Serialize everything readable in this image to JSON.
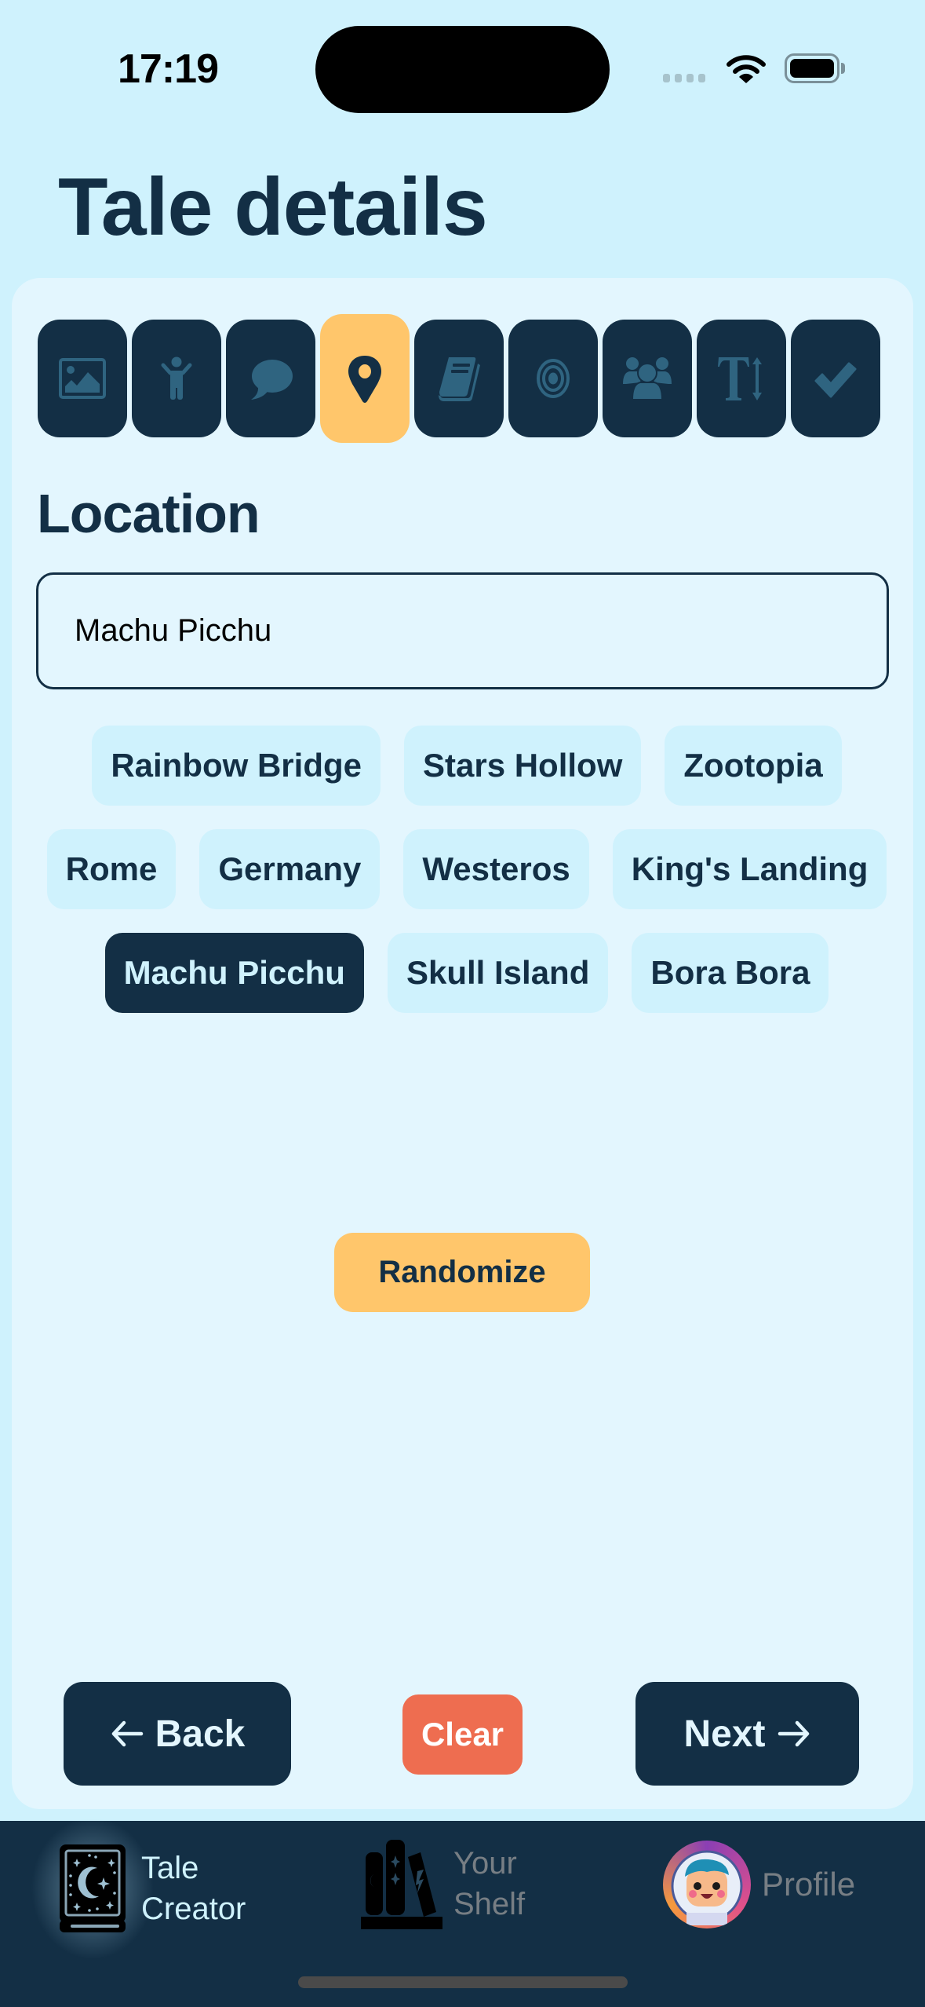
{
  "status_bar": {
    "time": "17:19",
    "icons": [
      "cellular-signal-icon",
      "wifi-icon",
      "battery-icon"
    ]
  },
  "page": {
    "title": "Tale details"
  },
  "steps": [
    {
      "icon": "image-icon",
      "label": "Image",
      "active": false
    },
    {
      "icon": "child-figure-icon",
      "label": "Character",
      "active": false
    },
    {
      "icon": "speech-bubble-icon",
      "label": "Dialogue",
      "active": false
    },
    {
      "icon": "map-pin-icon",
      "label": "Location",
      "active": true
    },
    {
      "icon": "book-icon",
      "label": "Story",
      "active": false
    },
    {
      "icon": "target-icon",
      "label": "Goal",
      "active": false
    },
    {
      "icon": "group-icon",
      "label": "Audience",
      "active": false
    },
    {
      "icon": "text-size-icon",
      "label": "Length",
      "active": false
    },
    {
      "icon": "checkmark-icon",
      "label": "Finish",
      "active": false
    }
  ],
  "location": {
    "section_title": "Location",
    "input_value": "Machu Picchu",
    "suggestions": [
      [
        "Rainbow Bridge",
        "Stars Hollow",
        "Zootopia"
      ],
      [
        "Rome",
        "Germany",
        "Westeros",
        "King's Landing"
      ],
      [
        "Machu Picchu",
        "Skull Island",
        "Bora Bora"
      ]
    ],
    "selected": "Machu Picchu"
  },
  "actions": {
    "randomize": "Randomize",
    "back": "Back",
    "clear": "Clear",
    "next": "Next"
  },
  "tab_bar": {
    "tabs": [
      {
        "line1": "Tale",
        "line2": "Creator",
        "active": true
      },
      {
        "line1": "Your",
        "line2": "Shelf",
        "active": false
      },
      {
        "line1": "Profile",
        "line2": "",
        "active": false
      }
    ]
  },
  "colors": {
    "background": "#cff2fd",
    "card": "#e3f6fe",
    "navy": "#132f45",
    "accent_yellow": "#ffc66b",
    "clear_red": "#ee6d50",
    "icon_muted": "#2f6480"
  }
}
